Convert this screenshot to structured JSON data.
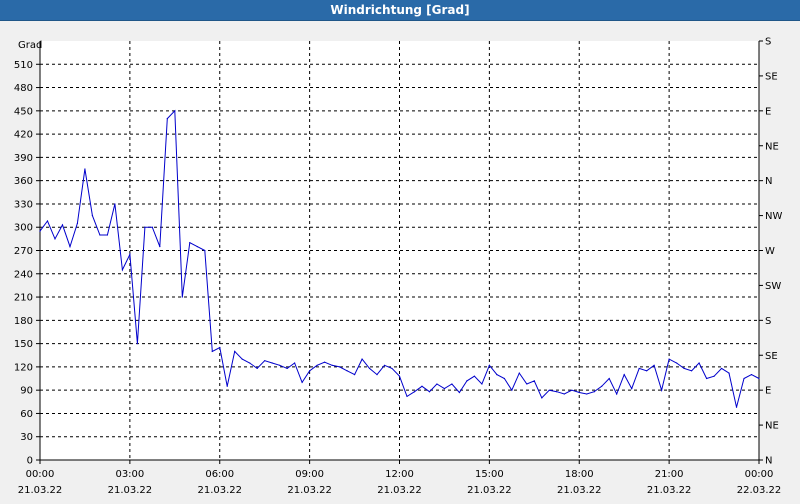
{
  "window": {
    "title": "Windrichtung [Grad]"
  },
  "chart_data": {
    "type": "line",
    "title": "Windrichtung [Grad]",
    "ylabel": "Grad",
    "ylim": [
      0,
      540
    ],
    "y_ticks": [
      0,
      30,
      60,
      90,
      120,
      150,
      180,
      210,
      240,
      270,
      300,
      330,
      360,
      390,
      420,
      450,
      480,
      510
    ],
    "right_axis_ticks": [
      {
        "value": 0,
        "label": "N"
      },
      {
        "value": 45,
        "label": "NE"
      },
      {
        "value": 90,
        "label": "E"
      },
      {
        "value": 135,
        "label": "SE"
      },
      {
        "value": 180,
        "label": "S"
      },
      {
        "value": 225,
        "label": "SW"
      },
      {
        "value": 270,
        "label": "W"
      },
      {
        "value": 315,
        "label": "NW"
      },
      {
        "value": 360,
        "label": "N"
      },
      {
        "value": 405,
        "label": "NE"
      },
      {
        "value": 450,
        "label": "E"
      },
      {
        "value": 495,
        "label": "SE"
      },
      {
        "value": 540,
        "label": "S"
      }
    ],
    "x_ticks": [
      {
        "time": "00:00",
        "date": "21.03.22"
      },
      {
        "time": "03:00",
        "date": "21.03.22"
      },
      {
        "time": "06:00",
        "date": "21.03.22"
      },
      {
        "time": "09:00",
        "date": "21.03.22"
      },
      {
        "time": "12:00",
        "date": "21.03.22"
      },
      {
        "time": "15:00",
        "date": "21.03.22"
      },
      {
        "time": "18:00",
        "date": "21.03.22"
      },
      {
        "time": "21:00",
        "date": "21.03.22"
      },
      {
        "time": "00:00",
        "date": "22.03.22"
      }
    ],
    "grid": true,
    "line_color": "#0000cc",
    "series": [
      {
        "hours": [
          0,
          0.25,
          0.5,
          0.75,
          1,
          1.25,
          1.5,
          1.75,
          2,
          2.25,
          2.5,
          2.75,
          3,
          3.25,
          3.5,
          3.75,
          4,
          4.25,
          4.5,
          4.75,
          5,
          5.25,
          5.5,
          5.75,
          6,
          6.25,
          6.5,
          6.75,
          7,
          7.25,
          7.5,
          7.75,
          8,
          8.25,
          8.5,
          8.75,
          9,
          9.25,
          9.5,
          9.75,
          10,
          10.25,
          10.5,
          10.75,
          11,
          11.25,
          11.5,
          11.75,
          12,
          12.25,
          12.5,
          12.75,
          13,
          13.25,
          13.5,
          13.75,
          14,
          14.25,
          14.5,
          14.75,
          15,
          15.25,
          15.5,
          15.75,
          16,
          16.25,
          16.5,
          16.75,
          17,
          17.25,
          17.5,
          17.75,
          18,
          18.25,
          18.5,
          18.75,
          19,
          19.25,
          19.5,
          19.75,
          20,
          20.25,
          20.5,
          20.75,
          21,
          21.25,
          21.5,
          21.75,
          22,
          22.25,
          22.5,
          22.75,
          23,
          23.25,
          23.5,
          23.75,
          24
        ],
        "values": [
          295,
          308,
          285,
          303,
          275,
          305,
          375,
          315,
          290,
          290,
          330,
          245,
          265,
          150,
          300,
          300,
          275,
          440,
          450,
          210,
          280,
          275,
          270,
          140,
          145,
          95,
          140,
          130,
          125,
          118,
          128,
          125,
          122,
          118,
          125,
          100,
          115,
          122,
          126,
          122,
          120,
          115,
          110,
          130,
          118,
          110,
          122,
          118,
          108,
          82,
          88,
          95,
          88,
          98,
          92,
          98,
          87,
          102,
          108,
          98,
          122,
          110,
          105,
          90,
          112,
          98,
          102,
          80,
          90,
          88,
          85,
          90,
          87,
          85,
          88,
          95,
          105,
          85,
          110,
          92,
          118,
          115,
          122,
          90,
          130,
          125,
          118,
          115,
          125,
          105,
          108,
          118,
          112,
          68,
          105,
          110,
          105,
          110,
          108
        ]
      }
    ]
  }
}
